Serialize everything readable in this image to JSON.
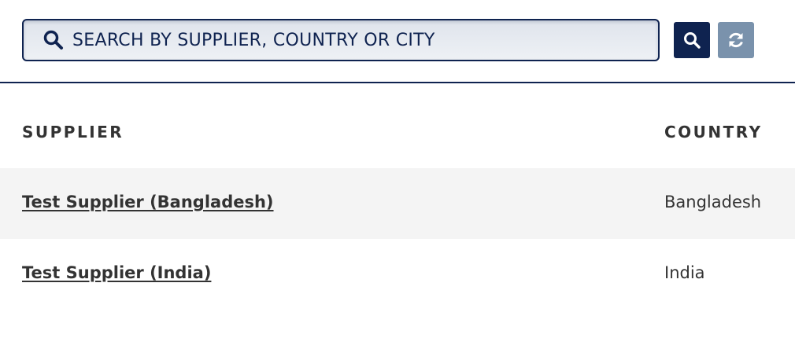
{
  "search": {
    "placeholder": "SEARCH BY SUPPLIER, COUNTRY OR CITY",
    "icon": "search-icon",
    "submit_icon": "search-icon",
    "reset_icon": "refresh-icon"
  },
  "colors": {
    "navy": "#0f2350",
    "reset_button": "#7a92ac",
    "row_stripe": "#f4f4f4",
    "text": "#333333"
  },
  "table": {
    "headers": {
      "supplier": "SUPPLIER",
      "country": "COUNTRY"
    },
    "rows": [
      {
        "supplier": "Test Supplier (Bangladesh)",
        "country": "Bangladesh"
      },
      {
        "supplier": "Test Supplier (India)",
        "country": "India"
      }
    ]
  }
}
